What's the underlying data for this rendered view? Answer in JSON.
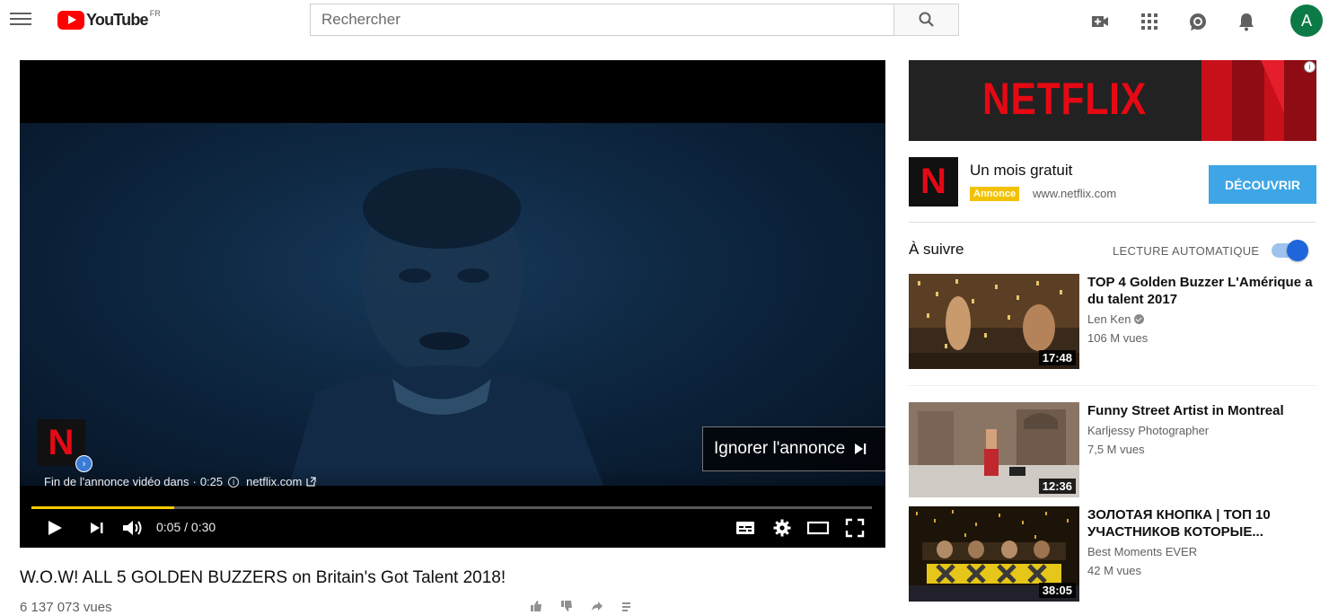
{
  "header": {
    "logo_text": "YouTube",
    "logo_country": "FR",
    "search_placeholder": "Rechercher",
    "avatar_letter": "A",
    "icons": [
      "menu-icon",
      "search-icon",
      "create-video-icon",
      "apps-icon",
      "messages-icon",
      "notifications-bell-icon"
    ]
  },
  "player": {
    "ad_logo_letter": "N",
    "ad_text": "Fin de l'annonce vidéo dans",
    "ad_countdown": "0:25",
    "ad_domain": "netflix.com",
    "skip_label": "Ignorer l'annonce",
    "time_display": "0:05 / 0:30",
    "progress_fraction": 0.17,
    "accent_color": "#ffcc00"
  },
  "video": {
    "title": "W.O.W! ALL 5 GOLDEN BUZZERS on Britain's Got Talent 2018!",
    "views": "6 137 073 vues"
  },
  "sidebar": {
    "banner_brand": "NETFLIX",
    "ad": {
      "logo_letter": "N",
      "title": "Un mois gratuit",
      "badge": "Annonce",
      "url": "www.netflix.com",
      "cta": "DÉCOUVRIR"
    },
    "up_next_label": "À suivre",
    "autoplay_label": "LECTURE AUTOMATIQUE",
    "autoplay_on": true,
    "recommendations": [
      {
        "title": "TOP 4 Golden Buzzer L'Amérique a du talent 2017",
        "channel": "Len Ken",
        "verified": true,
        "views": "106 M vues",
        "duration": "17:48"
      },
      {
        "title": "Funny Street Artist in Montreal",
        "channel": "Karljessy Photographer",
        "verified": false,
        "views": "7,5 M vues",
        "duration": "12:36"
      },
      {
        "title": "ЗОЛОТАЯ КНОПКА | ТОП 10 УЧАСТНИКОВ КОТОРЫЕ...",
        "channel": "Best Moments EVER",
        "verified": false,
        "views": "42 M vues",
        "duration": "38:05"
      }
    ]
  }
}
